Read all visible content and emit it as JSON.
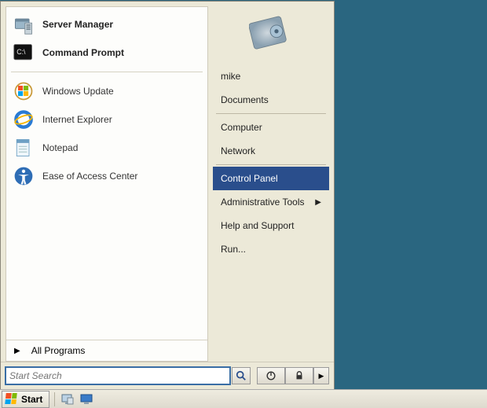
{
  "start_menu": {
    "pinned": [
      {
        "id": "server-manager",
        "label": "Server Manager"
      },
      {
        "id": "command-prompt",
        "label": "Command Prompt"
      }
    ],
    "recent": [
      {
        "id": "windows-update",
        "label": "Windows Update"
      },
      {
        "id": "internet-explorer",
        "label": "Internet Explorer"
      },
      {
        "id": "notepad",
        "label": "Notepad"
      },
      {
        "id": "ease-of-access",
        "label": "Ease of Access Center"
      }
    ],
    "all_programs_label": "All Programs",
    "search_placeholder": "Start Search",
    "right": {
      "user": "mike",
      "items": [
        {
          "id": "documents",
          "label": "Documents"
        },
        {
          "id": "computer",
          "label": "Computer",
          "sep_before": true
        },
        {
          "id": "network",
          "label": "Network"
        },
        {
          "id": "control-panel",
          "label": "Control Panel",
          "sep_before": true,
          "selected": true
        },
        {
          "id": "admin-tools",
          "label": "Administrative Tools",
          "submenu": true
        },
        {
          "id": "help-support",
          "label": "Help and Support"
        },
        {
          "id": "run",
          "label": "Run..."
        }
      ]
    }
  },
  "taskbar": {
    "start_label": "Start"
  }
}
